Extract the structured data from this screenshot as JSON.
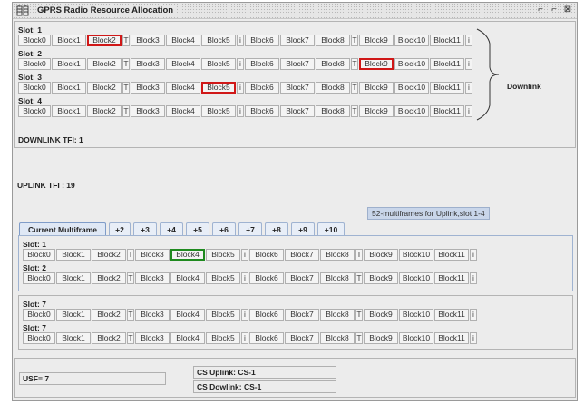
{
  "window": {
    "title": "GPRS Radio Resource Allocation",
    "minimize_glyph": "⌐",
    "maximize_glyph": "⌐",
    "close_glyph": "⊠"
  },
  "downlink": {
    "slots": [
      {
        "label": "Slot: 1",
        "highlighted": [
          "Block2"
        ]
      },
      {
        "label": "Slot: 2",
        "highlighted": [
          "Block9"
        ]
      },
      {
        "label": "Slot: 3",
        "highlighted": [
          "Block5"
        ]
      },
      {
        "label": "Slot: 4",
        "highlighted": []
      }
    ],
    "brace_label": "Downlink",
    "tfi": "DOWNLINK TFI: 1"
  },
  "uplink": {
    "tfi": "UPLINK TFI : 19",
    "info": "52-multiframes for Uplink,slot 1-4"
  },
  "tabs": [
    "Current Multiframe",
    "+2",
    "+3",
    "+4",
    "+5",
    "+6",
    "+7",
    "+8",
    "+9",
    "+10"
  ],
  "current_panel": {
    "slots": [
      {
        "label": "Slot: 1",
        "highlighted": [
          "Block4"
        ]
      },
      {
        "label": "Slot: 2",
        "highlighted": []
      }
    ]
  },
  "second_panel": {
    "slots": [
      {
        "label": "Slot: 7",
        "highlighted": []
      },
      {
        "label": "Slot: 7",
        "highlighted": []
      }
    ]
  },
  "blocks": [
    "Block0",
    "Block1",
    "Block2",
    "T",
    "Block3",
    "Block4",
    "Block5",
    "i",
    "Block6",
    "Block7",
    "Block8",
    "T",
    "Block9",
    "Block10",
    "Block11",
    "i"
  ],
  "bottom": {
    "usf": "USF= 7",
    "cs_uplink": "CS Uplink: CS-1",
    "cs_downlink": "CS Dowlink: CS-1"
  },
  "colors": {
    "highlight_red": "#d01818",
    "highlight_green": "#1f8a1f",
    "tab_blue": "#dfe8f5"
  }
}
